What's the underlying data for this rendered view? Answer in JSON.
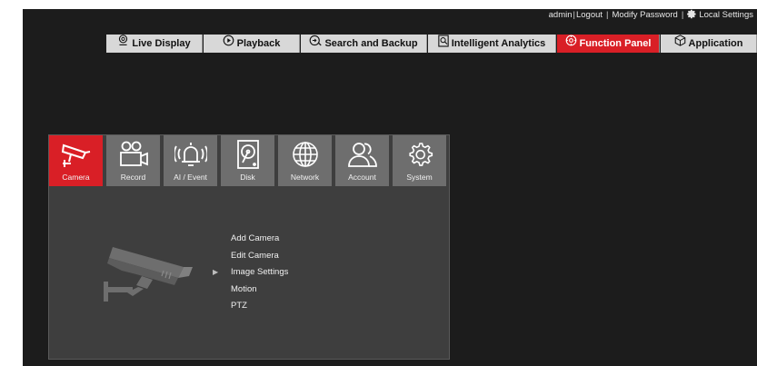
{
  "topbar": {
    "user": "admin",
    "logout": "Logout",
    "modify_password": "Modify Password",
    "local_settings": "Local Settings",
    "gear_icon": "gear-icon"
  },
  "nav": {
    "tabs": [
      {
        "label": "Live Display",
        "icon": "live-display-icon"
      },
      {
        "label": "Playback",
        "icon": "playback-icon"
      },
      {
        "label": "Search and Backup",
        "icon": "search-backup-icon"
      },
      {
        "label": "Intelligent Analytics",
        "icon": "intelligent-analytics-icon"
      },
      {
        "label": "Function Panel",
        "icon": "function-panel-icon",
        "active": true
      },
      {
        "label": "Application",
        "icon": "application-icon"
      }
    ]
  },
  "panel": {
    "icons": [
      {
        "label": "Camera",
        "icon": "camera-icon",
        "active": true
      },
      {
        "label": "Record",
        "icon": "record-icon"
      },
      {
        "label": "AI / Event",
        "icon": "ai-event-icon"
      },
      {
        "label": "Disk",
        "icon": "disk-icon"
      },
      {
        "label": "Network",
        "icon": "network-icon"
      },
      {
        "label": "Account",
        "icon": "account-icon"
      },
      {
        "label": "System",
        "icon": "system-icon"
      }
    ],
    "menu": [
      {
        "label": "Add Camera"
      },
      {
        "label": "Edit Camera"
      },
      {
        "label": "Image Settings",
        "selected": true
      },
      {
        "label": "Motion"
      },
      {
        "label": "PTZ"
      }
    ]
  },
  "colors": {
    "accent": "#d91f26",
    "background": "#1c1c1c",
    "panel": "#3e3e3e",
    "tile": "#6e6e6e",
    "tab": "#d8d8d8"
  }
}
